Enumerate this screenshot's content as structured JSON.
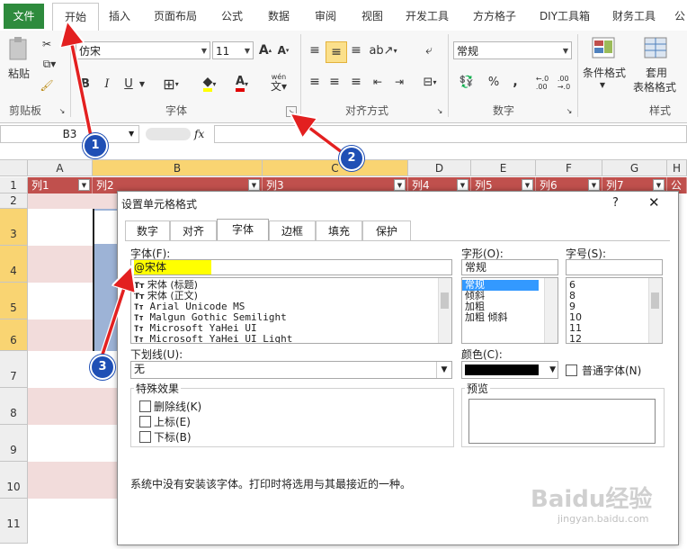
{
  "tabs": [
    "文件",
    "开始",
    "插入",
    "页面布局",
    "公式",
    "数据",
    "审阅",
    "视图",
    "开发工具",
    "方方格子",
    "DIY工具箱",
    "财务工具",
    "公"
  ],
  "ribbon": {
    "clipboard": {
      "paste": "粘贴",
      "label": "剪贴板"
    },
    "font": {
      "name": "仿宋",
      "size": "11",
      "label": "字体",
      "bold": "B",
      "italic": "I",
      "underline": "U",
      "wen": "wén"
    },
    "align": {
      "label": "对齐方式"
    },
    "number": {
      "format": "常规",
      "percent": "%",
      "comma": ",",
      "dec_inc": ".00→.0",
      "dec_dec": ".00→.0",
      "label": "数字"
    },
    "styles": {
      "cond": "条件格式",
      "table": "套用",
      "table2": "表格格式",
      "label": "样式"
    }
  },
  "formula_bar": {
    "namebox": "B3",
    "fx": "fx"
  },
  "sheet": {
    "columns": [
      "A",
      "B",
      "C",
      "D",
      "E",
      "F",
      "G",
      "H"
    ],
    "header_row": [
      "列1",
      "列2",
      "列3",
      "列4",
      "列5",
      "列6",
      "列7",
      "公"
    ],
    "rows": [
      "1",
      "2",
      "3",
      "4",
      "5",
      "6",
      "7",
      "8",
      "9",
      "10",
      "11"
    ]
  },
  "dialog": {
    "title": "设置单元格格式",
    "help": "?",
    "close": "✕",
    "tabs": [
      "数字",
      "对齐",
      "字体",
      "边框",
      "填充",
      "保护"
    ],
    "font_label": "字体(F):",
    "font_value": "@宋体",
    "font_list": [
      "宋体 (标题)",
      "宋体 (正文)",
      "Arial Unicode MS",
      "Malgun Gothic Semilight",
      "Microsoft YaHei UI",
      "Microsoft YaHei UI Light"
    ],
    "style_label": "字形(O):",
    "style_value": "常规",
    "style_list": [
      "常规",
      "倾斜",
      "加粗",
      "加粗 倾斜"
    ],
    "size_label": "字号(S):",
    "size_list": [
      "6",
      "8",
      "9",
      "10",
      "11",
      "12"
    ],
    "underline_label": "下划线(U):",
    "underline_value": "无",
    "color_label": "颜色(C):",
    "normal_font": "普通字体(N)",
    "effects_label": "特殊效果",
    "effects": [
      "删除线(K)",
      "上标(E)",
      "下标(B)"
    ],
    "preview_label": "预览",
    "note": "系统中没有安装该字体。打印时将选用与其最接近的一种。"
  },
  "annotations": [
    "1",
    "2",
    "3"
  ],
  "watermark": "Baidu经验",
  "watermark_url": "jingyan.baidu.com"
}
